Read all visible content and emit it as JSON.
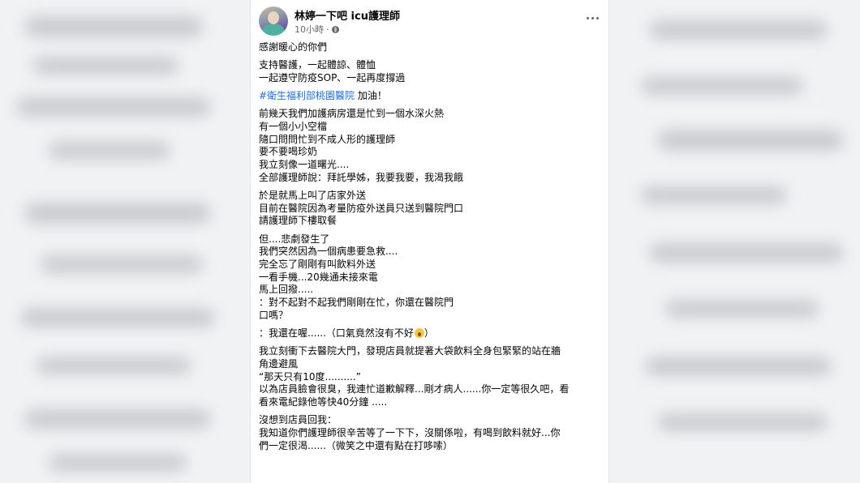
{
  "post": {
    "author": "林婷一下吧 icu護理師",
    "timestamp": "10小時",
    "separator": "·",
    "privacy_icon": "globe-icon",
    "more_icon": "more-options-icon",
    "paragraphs": [
      {
        "lines": [
          "感謝暖心的你們"
        ]
      },
      {
        "lines": [
          "支持醫護，一起體諒、體恤",
          "一起遵守防疫SOP、一起再度撐過"
        ]
      },
      {
        "hashtag": "#衛生福利部桃園醫院",
        "rest": " 加油！"
      },
      {
        "lines": [
          "前幾天我們加護病房還是忙到一個水深火熱",
          "有一個小小空檔",
          "隨口問問忙到不成人形的護理師",
          "要不要喝珍奶",
          "我立刻像一道曙光....",
          "全部護理師說：拜託學姊，我要我要，我渴我餓"
        ]
      },
      {
        "lines": [
          "於是就馬上叫了店家外送",
          "目前在醫院因為考量防疫外送員只送到醫院門口",
          "請護理師下樓取餐"
        ]
      },
      {
        "lines": [
          "但....悲劇發生了",
          "我們突然因為一個病患要急救....",
          "完全忘了剛剛有叫飲料外送",
          "一看手機...20幾通未接來電",
          "馬上回撥.....",
          "：對不起對不起我們剛剛在忙，你還在醫院門",
          "口嗎？"
        ]
      },
      {
        "lines": [
          "：我還在喔......（口氣竟然沒有不好"
        ],
        "emoji_after": "astonished-face-emoji",
        "tail": "）"
      },
      {
        "lines": [
          "我立刻衝下去醫院大門，發現店員就提著大袋飲料全身包緊緊的站在牆",
          "角邊避風",
          "“那天只有10度..........”",
          "以為店員臉會很臭，我連忙道歉解釋...剛才病人......你一定等很久吧，看",
          "看來電紀錄他等快40分鐘 ....."
        ]
      },
      {
        "lines": [
          "沒想到店員回我：",
          "我知道你們護理師很辛苦等了一下下，沒關係啦，有喝到飲料就好...你",
          "們一定很渴......（微笑之中還有點在打哆嗦）"
        ]
      }
    ]
  },
  "colors": {
    "hashtag": "#216fdb",
    "text": "#050505",
    "meta": "#65676b"
  }
}
